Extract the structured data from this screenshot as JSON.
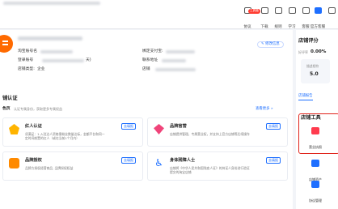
{
  "toolbar": {
    "badge": "工具箱",
    "items": [
      {
        "label": "协议",
        "icon": "document-icon"
      },
      {
        "label": "下载",
        "icon": "download-icon"
      },
      {
        "label": "规则",
        "icon": "book-icon"
      },
      {
        "label": "学习",
        "icon": "cap-icon"
      },
      {
        "label": "客服",
        "icon": "chat-icon"
      },
      {
        "label": "官方客服",
        "icon": "headset-icon"
      },
      {
        "label": "",
        "icon": "grid-icon"
      }
    ]
  },
  "shop": {
    "account_label": "淘宝账号名",
    "main_account_label": "登录账号",
    "alipay_label": "绑定支付宝:",
    "shop_id_label": "宣传号:",
    "contact_label": "联系地址",
    "shop_type_label": "店铺类型:",
    "shop_type_value": "企业",
    "shop_title_label": "店铺",
    "edit_button": "✎ 修改信息",
    "paren": "天)"
  },
  "certify": {
    "section_title": "铺认证",
    "sub_left": "色页",
    "sub_desc": "认证专属身份，获取更多专属权益",
    "view_more": "查看更多 »",
    "items": [
      {
        "title": "红人认证",
        "desc": "须满足：1.入驻达人资格需粉丝数量达标，金额平台和同一定时间前置的红人（或在当前1个月内）",
        "button": "去填报"
      },
      {
        "title": "品牌官营",
        "desc": "店铺提供管理，专属营业权，并支持上官方店铺等后续操作",
        "button": "去填报"
      },
      {
        "title": "品牌授权",
        "desc": "品牌方授权经营商品, 品牌授权权益",
        "button": "去填报"
      },
      {
        "title": "身体残障人士",
        "desc": "店铺将《中华人民共和国残疾人证》的持证人身份进行验证提交的淘宝店铺",
        "button": "去填报"
      }
    ]
  },
  "side": {
    "rating_title": "店铺评分",
    "good_rate_label": "好评率",
    "good_rate_value": "0.00%",
    "service_label": "描述相符",
    "service_score": "5.0",
    "tab_label": "店铺报告",
    "tools_title": "店铺工具",
    "tools": [
      {
        "label": "营业执照",
        "icon": "briefcase-icon"
      },
      {
        "label": "店铺资产",
        "icon": "wallet-icon"
      },
      {
        "label": "协议管理",
        "icon": "file-icon"
      }
    ]
  },
  "colors": {
    "accent": "#1e6fff",
    "logo": "#ff6a00",
    "highlight_border": "#e0241b"
  }
}
